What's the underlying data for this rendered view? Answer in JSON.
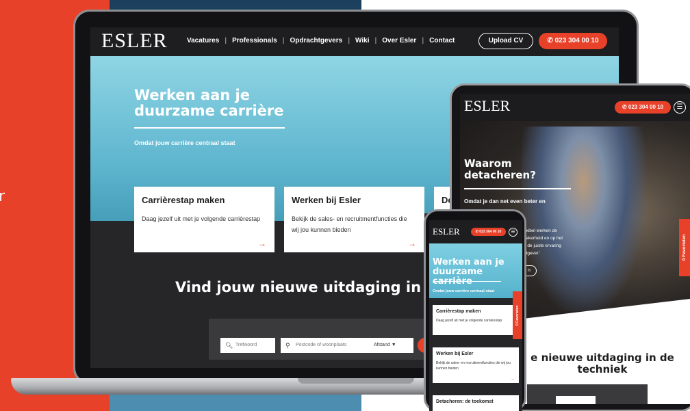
{
  "brand": {
    "accent": "#e8412a",
    "dark": "#262628",
    "hero_blue": "#6cc0d8"
  },
  "laptop": {
    "logo": "ESLER",
    "nav": {
      "items": [
        "Vacatures",
        "Professionals",
        "Opdrachtgevers",
        "Wiki",
        "Over Esler",
        "Contact"
      ],
      "separator": "|",
      "upload_cv": "Upload CV",
      "phone_icon": "phone-icon",
      "phone": "023 304 00 10"
    },
    "hero": {
      "title": "Werken aan je duurzame carrière",
      "subtitle": "Omdat jouw carrière centraal staat"
    },
    "cards": [
      {
        "title": "Carrièrestap maken",
        "desc": "Daag jezelf uit met je volgende carrièrestap",
        "arrow": "→"
      },
      {
        "title": "Werken bij Esler",
        "desc": "Bekijk de sales- en recruitmentfuncties die wij jou kunnen bieden",
        "arrow": "→"
      },
      {
        "title": "De",
        "desc": "",
        "arrow": ""
      }
    ],
    "find_title": "Vind jouw nieuwe uitdaging in",
    "search": {
      "keyword_placeholder": "Trefwoord",
      "postcode_placeholder": "Postcode of woonplaats",
      "distance_label": "Afstand",
      "distance_caret": "▼"
    }
  },
  "tablet": {
    "logo": "ESLER",
    "phone": "023 304 00 10",
    "menu_icon": "☰",
    "hero": {
      "title": "Waarom detacheren?",
      "subtitle_visible": "Omdat je dan net even beter en",
      "body_fragments": [
        "exibel werken de",
        "zekerheid en op het",
        "e de juiste ervaring",
        "htgever.'"
      ],
      "pill": "n"
    },
    "favorites": "0 Favorieten",
    "find_title": "e nieuwe uitdaging in de techniek"
  },
  "phone": {
    "logo": "ESLER",
    "phone": "023 304 00 10",
    "menu_icon": "☰",
    "hero": {
      "title": "Werken aan je duurzame carrière",
      "subtitle": "Omdat jouw carrière centraal staat"
    },
    "favorites": "0 Favorieten",
    "cards": [
      {
        "title": "Carrièrestap maken",
        "desc": "Daag jezelf uit met je volgende carrièrestap",
        "arrow": ""
      },
      {
        "title": "Werken bij Esler",
        "desc": "Bekijk de sales- en recruitmentfuncties die wij jou kunnen bieden",
        "arrow": "→"
      },
      {
        "title": "Detacheren: de toekomst",
        "desc": "",
        "arrow": ""
      }
    ]
  }
}
